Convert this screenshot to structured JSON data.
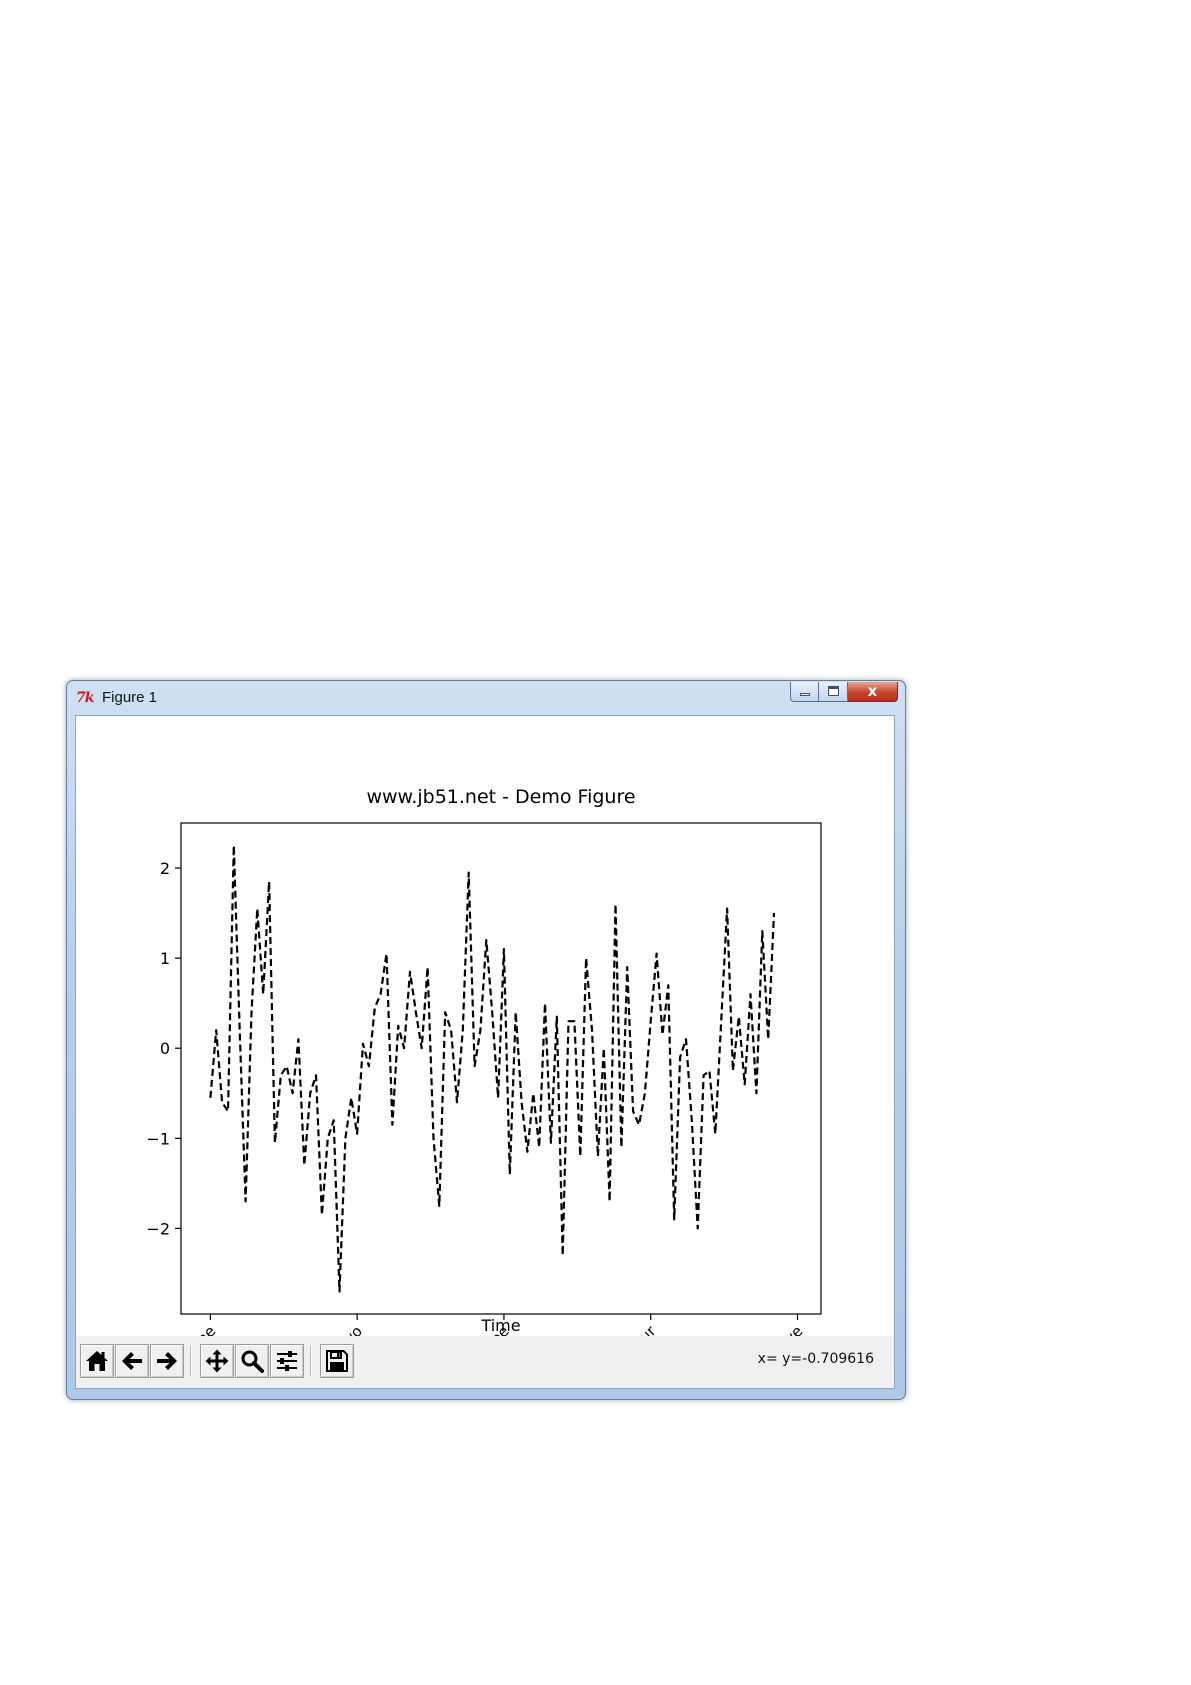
{
  "window": {
    "title": "Figure 1",
    "app_icon": "tk-feather-icon",
    "app_icon_text": "7k",
    "caption_buttons": [
      {
        "name": "minimize",
        "icon": "minimize-icon"
      },
      {
        "name": "maximize",
        "icon": "maximize-icon"
      },
      {
        "name": "close",
        "icon": "close-icon",
        "label": "x"
      }
    ]
  },
  "toolbar": {
    "buttons": [
      {
        "name": "home-button",
        "icon": "home-icon"
      },
      {
        "name": "back-button",
        "icon": "arrow-left-icon"
      },
      {
        "name": "forward-button",
        "icon": "arrow-right-icon"
      },
      {
        "name": "pan-button",
        "icon": "move-icon"
      },
      {
        "name": "zoom-button",
        "icon": "zoom-icon"
      },
      {
        "name": "configure-subplots-button",
        "icon": "sliders-icon"
      },
      {
        "name": "save-button",
        "icon": "save-icon"
      }
    ],
    "coordinates": "x= y=-0.709616"
  },
  "chart_data": {
    "type": "line",
    "title": "www.jb51.net - Demo Figure",
    "xlabel": "Time",
    "ylabel": "",
    "line_style": "dashed",
    "line_color": "#000000",
    "grid": false,
    "xticks": [
      0,
      25,
      50,
      75,
      100
    ],
    "xtick_labels": [
      "one",
      "two",
      "three",
      "four",
      "five"
    ],
    "xtick_rotation": 45,
    "yticks": [
      -2,
      -1,
      0,
      1,
      2
    ],
    "ytick_labels": [
      "−2",
      "−1",
      "0",
      "1",
      "2"
    ],
    "xlim": [
      -5,
      104
    ],
    "ylim": [
      -2.95,
      2.5
    ],
    "x": [
      0,
      1,
      2,
      3,
      4,
      5,
      6,
      7,
      8,
      9,
      10,
      11,
      12,
      13,
      14,
      15,
      16,
      17,
      18,
      19,
      20,
      21,
      22,
      23,
      24,
      25,
      26,
      27,
      28,
      29,
      30,
      31,
      32,
      33,
      34,
      35,
      36,
      37,
      38,
      39,
      40,
      41,
      42,
      43,
      44,
      45,
      46,
      47,
      48,
      49,
      50,
      51,
      52,
      53,
      54,
      55,
      56,
      57,
      58,
      59,
      60,
      61,
      62,
      63,
      64,
      65,
      66,
      67,
      68,
      69,
      70,
      71,
      72,
      73,
      74,
      75,
      76,
      77,
      78,
      79,
      80,
      81,
      82,
      83,
      84,
      85,
      86,
      87,
      88,
      89,
      90,
      91,
      92,
      93,
      94,
      95,
      96,
      97,
      98,
      99,
      100
    ],
    "y": [
      -0.55,
      0.2,
      -0.6,
      -0.7,
      2.25,
      0.2,
      -1.7,
      0.4,
      1.55,
      0.6,
      1.85,
      -1.05,
      -0.3,
      -0.2,
      -0.5,
      0.1,
      -1.3,
      -0.5,
      -0.3,
      -1.85,
      -1.0,
      -0.8,
      -2.7,
      -1.0,
      -0.55,
      -0.95,
      0.05,
      -0.2,
      0.45,
      0.6,
      1.05,
      -0.85,
      0.25,
      0.0,
      0.85,
      0.4,
      0.0,
      0.9,
      -1.0,
      -1.75,
      0.4,
      0.2,
      -0.6,
      0.2,
      1.95,
      -0.2,
      0.2,
      1.2,
      0.4,
      -0.55,
      1.1,
      -1.4,
      0.4,
      -0.6,
      -1.15,
      -0.5,
      -1.1,
      0.5,
      -1.05,
      0.35,
      -2.3,
      0.3,
      0.3,
      -1.2,
      1.0,
      0.2,
      -1.2,
      0.0,
      -1.7,
      1.6,
      -1.1,
      0.9,
      -0.7,
      -0.85,
      -0.5,
      0.3,
      1.05,
      0.15,
      0.7,
      -1.9,
      -0.1,
      0.1,
      -0.8,
      -2.0,
      -0.3,
      -0.25,
      -0.95,
      0.3,
      1.55,
      -0.25,
      0.35,
      -0.4,
      0.6,
      -0.5,
      1.3,
      0.1,
      1.5
    ]
  }
}
